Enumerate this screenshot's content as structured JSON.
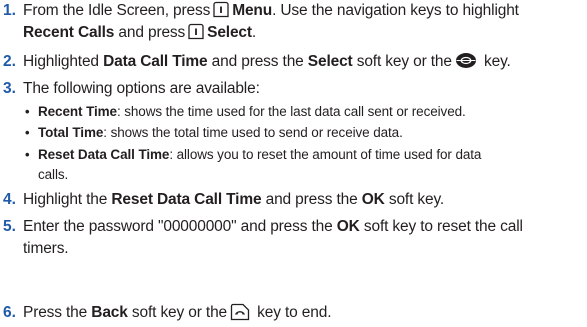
{
  "steps": [
    {
      "num": "1.",
      "line1_pre": "From the Idle Screen, press",
      "menu": "Menu",
      "line1_post": ". Use the navigation keys to highlight",
      "recent_calls": "Recent Calls",
      "and_press": " and press",
      "select": "Select",
      "period": "."
    },
    {
      "num": "2.",
      "pre": "Highlighted ",
      "data_call_time": "Data Call Time",
      "mid": " and press the ",
      "select": "Select",
      "post1": " soft key or the",
      "post2": " key."
    },
    {
      "num": "3.",
      "text": "The following options are available:",
      "bullets": [
        {
          "term": "Recent Time",
          "desc": ": shows the time used for the last data call sent or received."
        },
        {
          "term": "Total Time",
          "desc": ": shows the total time used to send or receive data."
        },
        {
          "term": "Reset Data Call Time",
          "desc": ": allows you to reset the amount of time used for data",
          "desc2": "calls."
        }
      ]
    },
    {
      "num": "4.",
      "pre": "Highlight the ",
      "term": "Reset Data Call Time",
      "mid": " and press the ",
      "ok": "OK",
      "post": " soft key."
    },
    {
      "num": "5.",
      "pre": "Enter the password \"00000000\" and press the ",
      "ok": "OK",
      "post": " soft key to reset the call",
      "line2": "timers."
    },
    {
      "num": "6.",
      "pre": "Press the ",
      "back": "Back",
      "mid": " soft key or the",
      "post": " key to end."
    }
  ],
  "icons": {
    "softkey_left": "left-soft-key-icon",
    "nav_key": "navigation-key-icon",
    "end_key": "end-key-icon"
  },
  "colors": {
    "number": "#1f5ba8",
    "text": "#231f20"
  }
}
